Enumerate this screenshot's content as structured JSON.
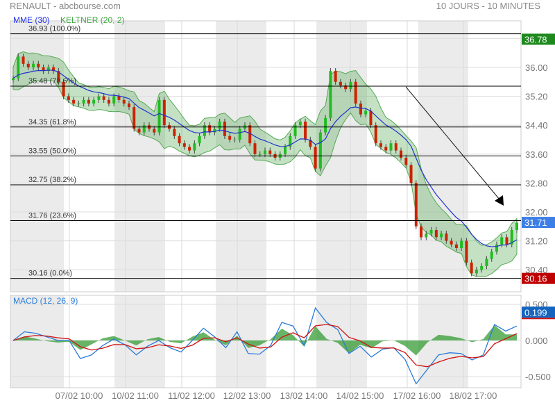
{
  "header": {
    "title": "RENAULT - abcbourse.com",
    "period": "10 JOURS - 10 MINUTES"
  },
  "chart_data": [
    {
      "type": "candlestick",
      "title": "RENAULT",
      "legend": [
        "MME (30)",
        "KELTNER (20, 2)"
      ],
      "ylim": [
        29.9,
        37.2
      ],
      "yticks": [
        "36.80",
        "36.00",
        "35.20",
        "34.40",
        "33.60",
        "32.80",
        "32.00",
        "31.20",
        "30.40"
      ],
      "ytick_values": [
        36.8,
        36.0,
        35.2,
        34.4,
        33.6,
        32.8,
        32.0,
        31.2,
        30.4
      ],
      "xticks": [
        "07/02 10:00",
        "10/02 11:00",
        "11/02 12:00",
        "12/02 13:00",
        "13/02 14:00",
        "14/02 15:00",
        "17/02 16:00",
        "18/02 17:00"
      ],
      "closes": [
        35.7,
        36.3,
        36.1,
        36.0,
        36.1,
        36.0,
        35.9,
        36.0,
        35.9,
        35.6,
        35.2,
        35.1,
        35.0,
        35.0,
        35.1,
        35.0,
        35.1,
        35.2,
        35.1,
        35.0,
        35.2,
        35.1,
        35.0,
        34.9,
        34.3,
        34.2,
        34.4,
        34.3,
        34.2,
        35.1,
        34.4,
        34.3,
        34.1,
        33.9,
        33.8,
        33.7,
        33.9,
        34.1,
        34.4,
        34.2,
        34.3,
        34.5,
        34.1,
        34.0,
        34.0,
        34.3,
        34.4,
        33.9,
        33.6,
        33.6,
        33.7,
        33.6,
        33.5,
        33.6,
        33.8,
        34.1,
        34.4,
        34.5,
        34.0,
        33.8,
        33.2,
        34.2,
        34.6,
        35.9,
        35.6,
        35.5,
        35.4,
        35.6,
        35.0,
        34.7,
        34.8,
        34.4,
        33.9,
        33.8,
        33.7,
        33.9,
        33.7,
        33.5,
        33.3,
        32.8,
        31.6,
        31.3,
        31.4,
        31.5,
        31.3,
        31.4,
        31.2,
        31.1,
        31.0,
        31.2,
        30.6,
        30.3,
        30.4,
        30.5,
        30.7,
        30.9,
        31.1,
        31.3,
        31.1,
        31.5,
        31.7
      ],
      "fibonacci": [
        {
          "label": "36.93  (100.0%)",
          "value": 36.93
        },
        {
          "label": "35.48  (78.6%)",
          "value": 35.48
        },
        {
          "label": "34.35  (61.8%)",
          "value": 34.35
        },
        {
          "label": "33.55  (50.0%)",
          "value": 33.55
        },
        {
          "label": "32.75  (38.2%)",
          "value": 32.75
        },
        {
          "label": "31.76  (23.6%)",
          "value": 31.76
        },
        {
          "label": "30.16  (0.0%)",
          "value": 30.16
        }
      ],
      "badges": [
        {
          "label": "36.78",
          "value": 36.78,
          "color": "#1e8a1e"
        },
        {
          "label": "31.71",
          "value": 31.71,
          "color": "#3d7fe6"
        },
        {
          "label": "30.16",
          "value": 30.16,
          "color": "#c00000"
        }
      ]
    },
    {
      "type": "line",
      "title": "MACD (12, 26, 9)",
      "ylim": [
        -0.7,
        0.6
      ],
      "yticks": [
        "0.500",
        "0.000",
        "-0.500"
      ],
      "ytick_values": [
        0.5,
        0,
        -0.5
      ],
      "macd": [
        0,
        0.12,
        0.1,
        0.05,
        0.0,
        0,
        -0.25,
        -0.2,
        -0.07,
        0.02,
        -0.06,
        -0.2,
        -0.08,
        0.0,
        -0.1,
        -0.16,
        0,
        0.17,
        0.05,
        -0.1,
        0.12,
        -0.18,
        -0.19,
        -0.07,
        0.25,
        0.2,
        -0.07,
        0.45,
        0.25,
        0.15,
        -0.18,
        -0.08,
        -0.23,
        -0.12,
        -0.1,
        -0.26,
        -0.6,
        -0.4,
        -0.2,
        -0.17,
        -0.18,
        -0.27,
        -0.2,
        0.22,
        0.13,
        0.2
      ],
      "badge": {
        "label": "0.199",
        "value": 0.199,
        "color": "#1565c0"
      }
    }
  ],
  "colors": {
    "up": "#22bb22",
    "down": "#cc2200",
    "mme": "#2233cc",
    "keltner": "#55aa55",
    "macd": "#2a7bd8",
    "signal": "#d01010"
  }
}
